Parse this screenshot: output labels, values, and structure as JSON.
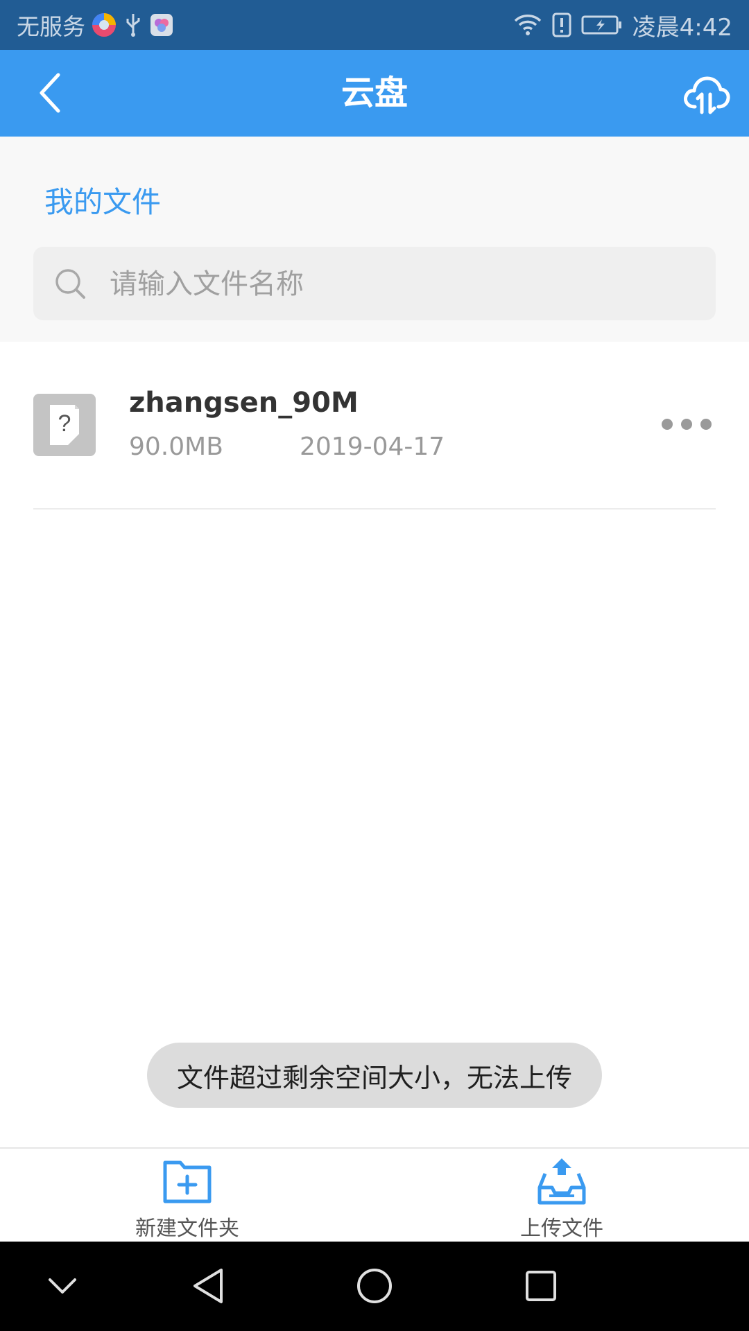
{
  "status_bar": {
    "carrier": "无服务",
    "time": "凌晨4:42",
    "icons": [
      "browser-app-icon",
      "usb-icon",
      "app-icon",
      "wifi-icon",
      "alert-icon",
      "battery-charging-icon"
    ]
  },
  "header": {
    "title": "云盘",
    "back_icon": "chevron-left-icon",
    "action_icon": "cloud-transfer-icon"
  },
  "section": {
    "title": "我的文件"
  },
  "search": {
    "placeholder": "请输入文件名称",
    "value": ""
  },
  "files": [
    {
      "name": "zhangsen_90M",
      "size": "90.0MB",
      "date": "2019-04-17",
      "icon": "unknown-file-icon"
    }
  ],
  "toast": {
    "message": "文件超过剩余空间大小，无法上传"
  },
  "bottom_bar": {
    "new_folder_label": "新建文件夹",
    "upload_label": "上传文件"
  },
  "colors": {
    "status_bar": "#215c94",
    "header": "#3a9af0",
    "accent": "#3a9af0"
  }
}
